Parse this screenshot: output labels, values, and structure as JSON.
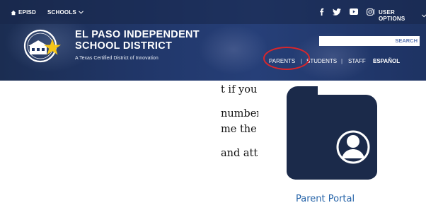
{
  "header": {
    "home_label": "EPISD",
    "schools_label": "SCHOOLS",
    "user_options_label": "USER OPTIONS",
    "separator": "|",
    "district_name_line1": "EL PASO INDEPENDENT",
    "district_name_line2": "SCHOOL DISTRICT",
    "tagline": "A Texas Certified District of Innovation",
    "search_label": "SEARCH",
    "nav": [
      "PARENTS",
      "|",
      "STUDENTS",
      "|",
      "STAFF",
      "ESPAÑOL"
    ],
    "highlight_color": "#d9262b"
  },
  "article": {
    "lines": [
      "t if you forgot your username",
      "number or SSN that you used",
      "me the same way you did for",
      "and attendance records as"
    ]
  },
  "portal": {
    "label": "Parent Portal",
    "icon": "folder-user-icon"
  }
}
